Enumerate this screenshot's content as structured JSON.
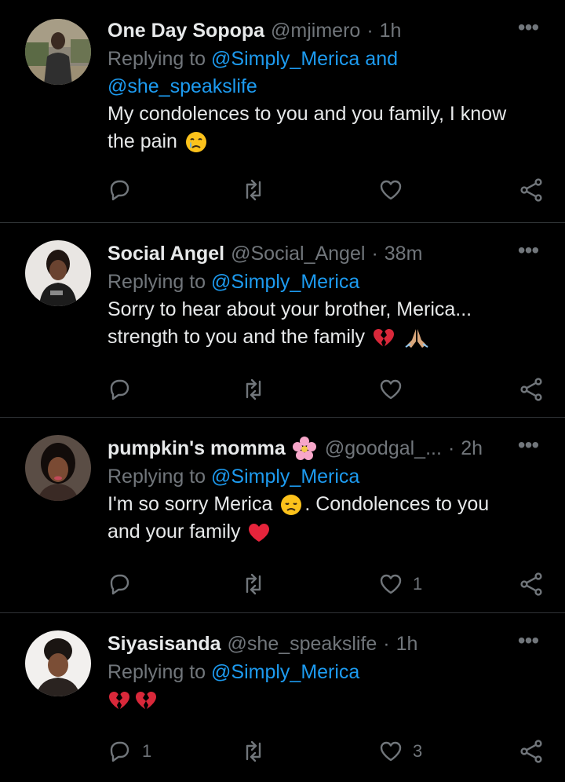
{
  "tweets": [
    {
      "name": "One Day Sopopa",
      "name_suffix": "",
      "handle": "@mjimero",
      "dot": "·",
      "time": "1h",
      "replying_prefix": "Replying to",
      "replying_links": [
        "@Simply_Merica and",
        "@she_speakslife"
      ],
      "text_line1": "My condolences to you and you family, I know",
      "text_line2": "the pain",
      "text_emoji": "crying-face",
      "reply_count": "",
      "retweet_count": "",
      "like_count": ""
    },
    {
      "name": "Social Angel",
      "handle": "@Social_Angel",
      "dot": "·",
      "time": "38m",
      "replying_prefix": "Replying to",
      "replying_links": [
        "@Simply_Merica"
      ],
      "text_line1": "Sorry to hear about your brother, Merica...",
      "text_line2": "strength to you and the family",
      "text_emoji": "broken-heart, folded-hands",
      "reply_count": "",
      "retweet_count": "",
      "like_count": ""
    },
    {
      "name": "pumpkin's momma",
      "name_emoji": "cherry-blossom",
      "handle": "@goodgal_...",
      "dot": "·",
      "time": "2h",
      "replying_prefix": "Replying to",
      "replying_links": [
        "@Simply_Merica"
      ],
      "text_line1a": "I'm so sorry Merica",
      "text_line1b": ". Condolences to you",
      "text_line2": "and your family",
      "text_emoji": "disappointed-face, red-heart",
      "reply_count": "",
      "retweet_count": "",
      "like_count": "1"
    },
    {
      "name": "Siyasisanda",
      "handle": "@she_speakslife",
      "dot": "·",
      "time": "1h",
      "replying_prefix": "Replying to",
      "replying_links": [
        "@Simply_Merica"
      ],
      "text_emoji": "broken-heart, broken-heart",
      "reply_count": "1",
      "retweet_count": "",
      "like_count": "3"
    }
  ],
  "colors": {
    "background": "#000000",
    "text": "#e7e9ea",
    "muted": "#71767b",
    "link": "#1d9bf0",
    "divider": "#2f3336"
  }
}
